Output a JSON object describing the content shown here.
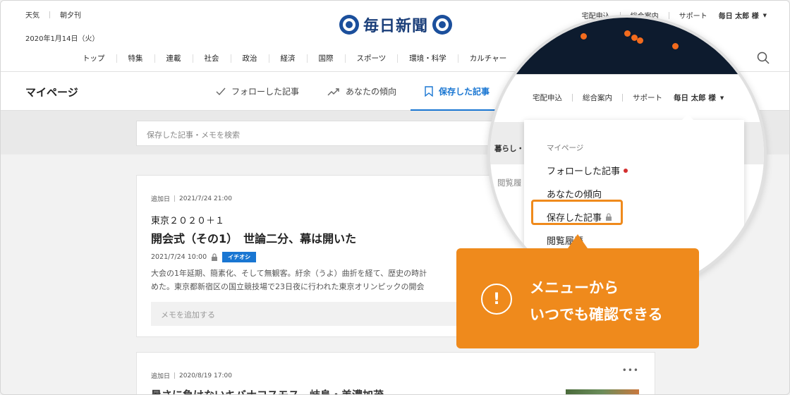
{
  "header": {
    "weather": "天気",
    "edition": "朝夕刊",
    "date": "2020年1月14日（火）",
    "logo_text": "毎日新聞",
    "right_links": [
      "宅配申込",
      "総合案内",
      "サポート"
    ],
    "user": "毎日 太郎 様",
    "nav": [
      "トップ",
      "特集",
      "連載",
      "社会",
      "政治",
      "経済",
      "国際",
      "スポーツ",
      "環境・科学",
      "カルチャー"
    ]
  },
  "mypage": {
    "title": "マイページ",
    "tabs": [
      {
        "label": "フォローした記事",
        "icon": "check-icon"
      },
      {
        "label": "あなたの傾向",
        "icon": "trend-icon"
      },
      {
        "label": "保存した記事",
        "icon": "bookmark-icon"
      }
    ],
    "search_placeholder": "保存した記事・メモを検索"
  },
  "cards": [
    {
      "added_label": "追加日",
      "added_at": "2021/7/24 21:00",
      "kicker": "東京２０２０＋１",
      "headline": "開会式（その1）　世論二分、幕は開いた",
      "published": "2021/7/24 10:00",
      "badge": "イチオシ",
      "summary_1": "大会の1年延期、簡素化、そして無観客。紆余（うよ）曲折を経て、歴史の時計",
      "summary_2": "めた。東京都新宿区の国立競技場で23日夜に行われた東京オリンピックの開会",
      "memo_placeholder": "メモを追加する"
    },
    {
      "added_label": "追加日",
      "added_at": "2020/8/19 17:00",
      "headline": "暑さに負けないキバナコスモス　岐阜・美濃加茂"
    }
  ],
  "magnifier": {
    "menu_links": [
      "宅配申込",
      "総合案内",
      "サポート"
    ],
    "user": "毎日 太郎 様",
    "left_text_1": "暮らし・",
    "left_text_2": "閲覧履",
    "dropdown": {
      "heading": "マイページ",
      "items": [
        "フォローした記事",
        "あなたの傾向",
        "保存した記事",
        "閲覧履歴"
      ]
    }
  },
  "callout": {
    "line1": "メニューから",
    "line2": "いつでも確認できる",
    "icon": "!"
  },
  "colors": {
    "accent_blue": "#1976d2",
    "callout_orange": "#ef8a1c",
    "logo_blue": "#1b4f9c",
    "notification_red": "#d32f2f"
  }
}
